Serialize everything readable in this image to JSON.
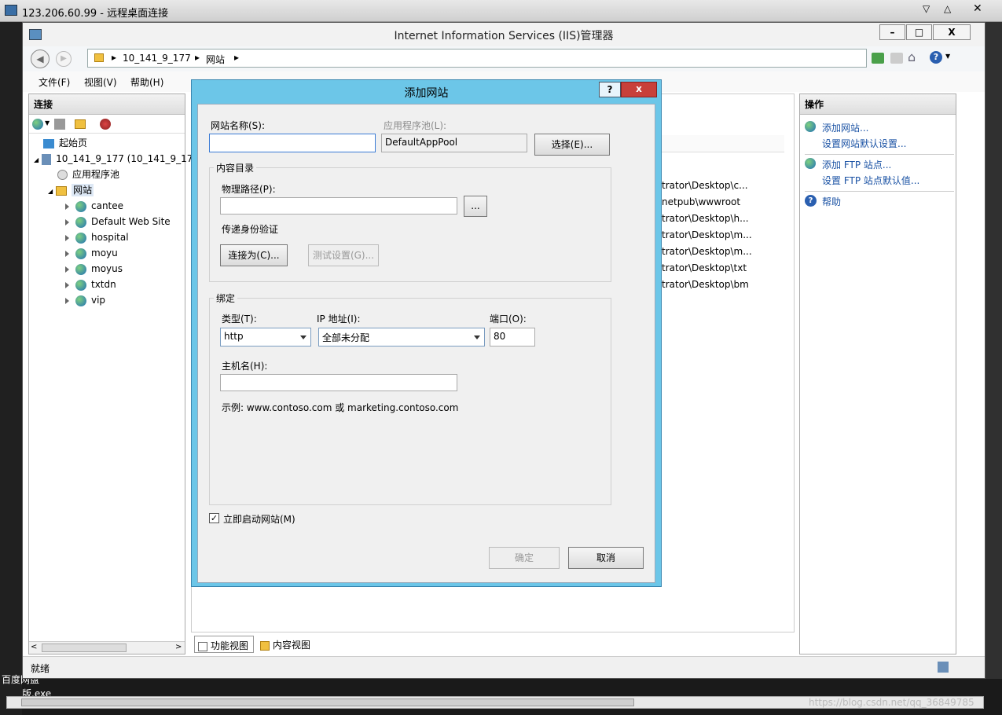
{
  "rdp": {
    "title": "123.206.60.99 - 远程桌面连接"
  },
  "window": {
    "title": "Internet Information Services (IIS)管理器",
    "min": "–",
    "max": "□",
    "close": "X"
  },
  "address": {
    "crumbs": [
      "10_141_9_177",
      "网站"
    ]
  },
  "menu": [
    "文件(F)",
    "视图(V)",
    "帮助(H)"
  ],
  "connections": {
    "header": "连接",
    "tree": {
      "start": "起始页",
      "server": "10_141_9_177 (10_141_9_17",
      "apppools": "应用程序池",
      "sites": "网站",
      "site_list": [
        "cantee",
        "Default Web Site",
        "hospital",
        "moyu",
        "moyus",
        "txtdn",
        "vip"
      ]
    }
  },
  "center": {
    "paths": [
      "trator\\Desktop\\c...",
      "netpub\\wwwroot",
      "trator\\Desktop\\h...",
      "trator\\Desktop\\m...",
      "trator\\Desktop\\m...",
      "trator\\Desktop\\txt",
      "trator\\Desktop\\bm"
    ],
    "view_tabs": {
      "features": "功能视图",
      "content": "内容视图"
    }
  },
  "actions": {
    "header": "操作",
    "add_site": "添加网站...",
    "site_defaults": "设置网站默认设置...",
    "add_ftp": "添加 FTP 站点...",
    "ftp_defaults": "设置 FTP 站点默认值...",
    "help": "帮助"
  },
  "status": {
    "text": "就绪"
  },
  "dialog": {
    "title": "添加网站",
    "help_btn": "?",
    "close_btn": "x",
    "site_name_label": "网站名称(S):",
    "site_name_value": "",
    "app_pool_label": "应用程序池(L):",
    "app_pool_value": "DefaultAppPool",
    "select_btn": "选择(E)...",
    "content_group": "内容目录",
    "phys_path_label": "物理路径(P):",
    "phys_path_value": "",
    "browse_btn": "...",
    "pass_auth_label": "传递身份验证",
    "connect_as_btn": "连接为(C)...",
    "test_btn": "测试设置(G)...",
    "binding_group": "绑定",
    "type_label": "类型(T):",
    "type_value": "http",
    "ip_label": "IP 地址(I):",
    "ip_value": "全部未分配",
    "port_label": "端口(O):",
    "port_value": "80",
    "host_label": "主机名(H):",
    "host_value": "",
    "example": "示例: www.contoso.com 或 marketing.contoso.com",
    "start_label": "立即启动网站(M)",
    "start_checked": true,
    "ok_btn": "确定",
    "cancel_btn": "取消"
  },
  "desktop": {
    "text1": "百度网盘",
    "text2": "版.exe",
    "watermark": "https://blog.csdn.net/qq_36849785"
  }
}
